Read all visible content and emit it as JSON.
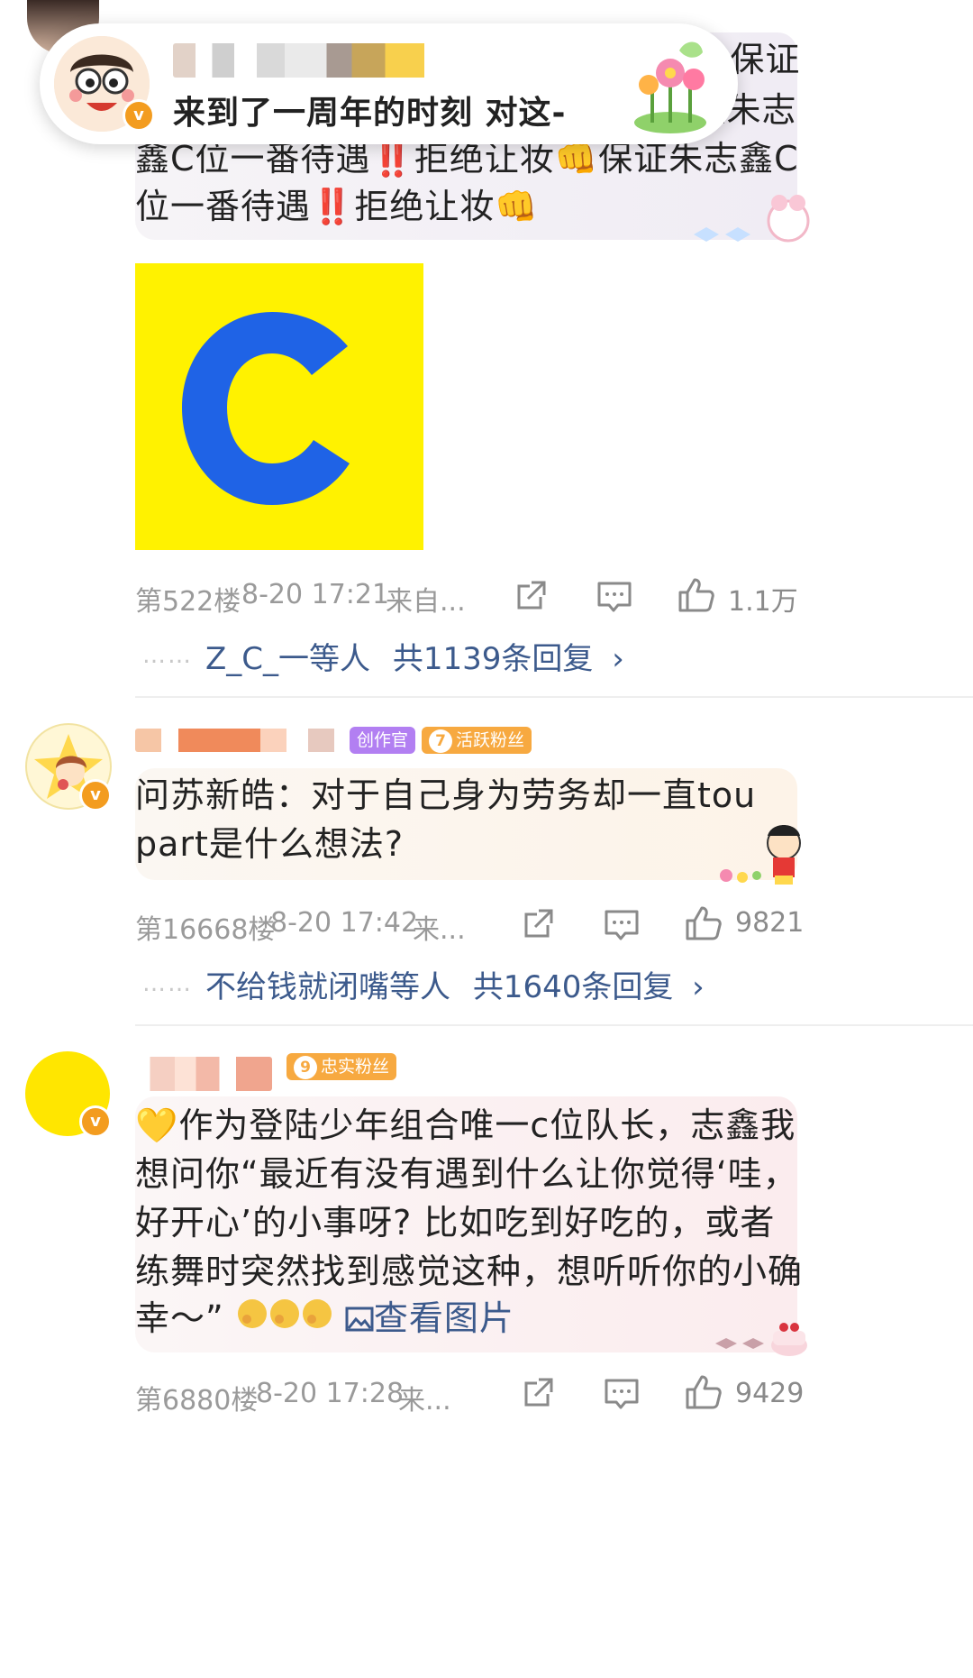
{
  "popup": {
    "title": "来到了一周年的时刻 对这-"
  },
  "comments": [
    {
      "text_lines": [
        "让妆👊保证",
        "👊保证朱志",
        "鑫C位一番待遇‼️拒绝让妆👊保证朱志鑫C",
        "位一番待遇‼️拒绝让妆👊"
      ],
      "image_letter": "C",
      "image_colors": {
        "bg": "#fff200",
        "letter": "#1f63e6"
      },
      "floor": "第522楼",
      "datetime": "8-20 17:21",
      "source": "来自...",
      "likes": "1.1万",
      "reply_user": "Z_C_一等人",
      "reply_count": "共1139条回复",
      "reply_chevron": "›"
    },
    {
      "tags": {
        "creator": "创作官",
        "fan_level": "7",
        "fan_label": "活跃粉丝"
      },
      "text_lines": [
        "问苏新皓：对于自己身为劳务却一直tou",
        "part是什么想法?"
      ],
      "floor": "第16668楼",
      "datetime": "8-20 17:42",
      "source": "来...",
      "likes": "9821",
      "reply_user": "不给钱就闭嘴等人",
      "reply_count": "共1640条回复",
      "reply_chevron": "›"
    },
    {
      "tags": {
        "fan_level": "9",
        "fan_label": "忠实粉丝"
      },
      "text_lines": [
        "💛作为登陆少年组合唯一c位队长，志鑫我",
        "想问你“最近有没有遇到什么让你觉得‘哇，",
        "好开心’的小事呀? 比如吃到好吃的，或者",
        "练舞时突然找到感觉这种，想听听你的小确",
        "幸～”"
      ],
      "view_image_label": "查看图片",
      "floor": "第6880楼",
      "datetime": "8-20 17:28",
      "source": "来...",
      "likes": "9429"
    }
  ],
  "colors": {
    "link_blue": "#3c5a8c",
    "meta_gray": "#9a9a9a",
    "verified_orange": "#f39c1f",
    "tag_purple": "#b27ff2",
    "tag_orange": "#f7a940"
  },
  "icons": [
    "share-icon",
    "comment-icon",
    "like-icon",
    "verified-badge-icon",
    "chevron-right-icon"
  ]
}
